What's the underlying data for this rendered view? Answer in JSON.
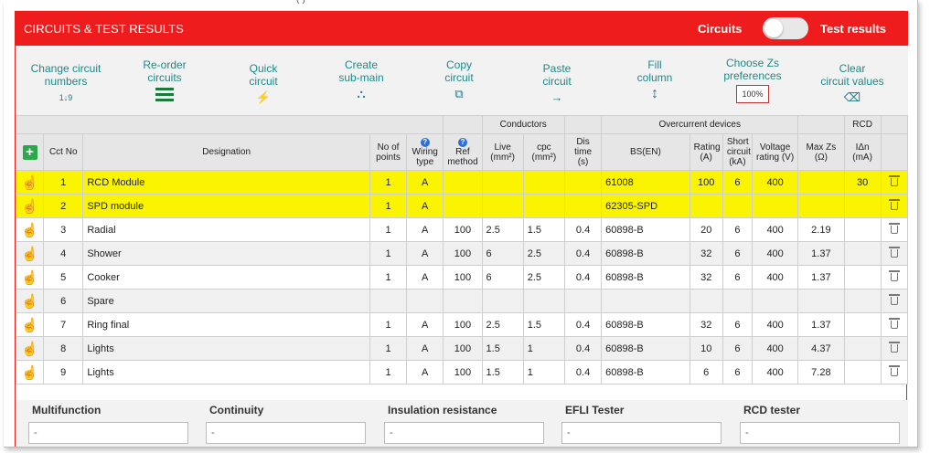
{
  "header": {
    "title": "CIRCUITS & TEST RESULTS",
    "toggle_left_label": "Circuits",
    "toggle_right_label": "Test results"
  },
  "topstrip": {
    "stub": "(·)"
  },
  "toolbar": [
    {
      "label1": "Change circuit",
      "label2": "numbers",
      "icon": "1↓9"
    },
    {
      "label1": "Re-order",
      "label2": "circuits",
      "icon": "hamburger"
    },
    {
      "label1": "Quick",
      "label2": "circuit",
      "icon": "⚡"
    },
    {
      "label1": "Create",
      "label2": "sub-main",
      "icon": "⛬"
    },
    {
      "label1": "Copy",
      "label2": "circuit",
      "icon": "⧉"
    },
    {
      "label1": "Paste",
      "label2": "circuit",
      "icon": "→"
    },
    {
      "label1": "Fill",
      "label2": "column",
      "icon": "↕"
    },
    {
      "label1": "Choose Zs",
      "label2": "preferences",
      "badge": "100%"
    },
    {
      "label1": "Clear",
      "label2": "circuit values",
      "icon": "⌫"
    }
  ],
  "table": {
    "group_headers": {
      "conductors": "Conductors",
      "overcurrent": "Overcurrent devices",
      "rcd": "RCD"
    },
    "columns": {
      "cct": "Cct No",
      "designation": "Designation",
      "points": "No of points",
      "wiring": "Wiring type",
      "ref": "Ref method",
      "live": "Live (mm²)",
      "cpc": "cpc (mm²)",
      "dis": "Dis time (s)",
      "bs": "BS(EN)",
      "rating": "Rating (A)",
      "short": "Short circuit (kA)",
      "voltage": "Voltage rating (V)",
      "maxzs": "Max Zs (Ω)",
      "idn": "IΔn (mA)"
    },
    "rows": [
      {
        "no": "1",
        "designation": "RCD Module",
        "points": "1",
        "wiring": "A",
        "ref": "",
        "live": "",
        "cpc": "",
        "dis": "",
        "bs": "61008",
        "rating": "100",
        "short": "6",
        "voltage": "400",
        "maxzs": "",
        "idn": "30",
        "highlight": true
      },
      {
        "no": "2",
        "designation": "SPD module",
        "points": "1",
        "wiring": "A",
        "ref": "",
        "live": "",
        "cpc": "",
        "dis": "",
        "bs": "62305-SPD",
        "rating": "",
        "short": "",
        "voltage": "",
        "maxzs": "",
        "idn": "",
        "highlight": true
      },
      {
        "no": "3",
        "designation": "Radial",
        "points": "1",
        "wiring": "A",
        "ref": "100",
        "live": "2.5",
        "cpc": "1.5",
        "dis": "0.4",
        "bs": "60898-B",
        "rating": "20",
        "short": "6",
        "voltage": "400",
        "maxzs": "2.19",
        "idn": ""
      },
      {
        "no": "4",
        "designation": "Shower",
        "points": "1",
        "wiring": "A",
        "ref": "100",
        "live": "6",
        "cpc": "2.5",
        "dis": "0.4",
        "bs": "60898-B",
        "rating": "32",
        "short": "6",
        "voltage": "400",
        "maxzs": "1.37",
        "idn": ""
      },
      {
        "no": "5",
        "designation": "Cooker",
        "points": "1",
        "wiring": "A",
        "ref": "100",
        "live": "6",
        "cpc": "2.5",
        "dis": "0.4",
        "bs": "60898-B",
        "rating": "32",
        "short": "6",
        "voltage": "400",
        "maxzs": "1.37",
        "idn": ""
      },
      {
        "no": "6",
        "designation": "Spare",
        "points": "",
        "wiring": "",
        "ref": "",
        "live": "",
        "cpc": "",
        "dis": "",
        "bs": "",
        "rating": "",
        "short": "",
        "voltage": "",
        "maxzs": "",
        "idn": ""
      },
      {
        "no": "7",
        "designation": "Ring final",
        "points": "1",
        "wiring": "A",
        "ref": "100",
        "live": "2.5",
        "cpc": "1.5",
        "dis": "0.4",
        "bs": "60898-B",
        "rating": "32",
        "short": "6",
        "voltage": "400",
        "maxzs": "1.37",
        "idn": ""
      },
      {
        "no": "8",
        "designation": "Lights",
        "points": "1",
        "wiring": "A",
        "ref": "100",
        "live": "1.5",
        "cpc": "1",
        "dis": "0.4",
        "bs": "60898-B",
        "rating": "10",
        "short": "6",
        "voltage": "400",
        "maxzs": "4.37",
        "idn": ""
      },
      {
        "no": "9",
        "designation": "Lights",
        "points": "1",
        "wiring": "A",
        "ref": "100",
        "live": "1.5",
        "cpc": "1",
        "dis": "0.4",
        "bs": "60898-B",
        "rating": "6",
        "short": "6",
        "voltage": "400",
        "maxzs": "7.28",
        "idn": ""
      }
    ]
  },
  "testers": [
    {
      "label": "Multifunction",
      "value": "-"
    },
    {
      "label": "Continuity",
      "value": "-"
    },
    {
      "label": "Insulation resistance",
      "value": "-"
    },
    {
      "label": "EFLI Tester",
      "value": "-"
    },
    {
      "label": "RCD tester",
      "value": "-"
    }
  ],
  "colors": {
    "header_red": "#ee1c1c",
    "accent_teal": "#1b8a8a",
    "highlight_yellow": "#fbf400"
  }
}
